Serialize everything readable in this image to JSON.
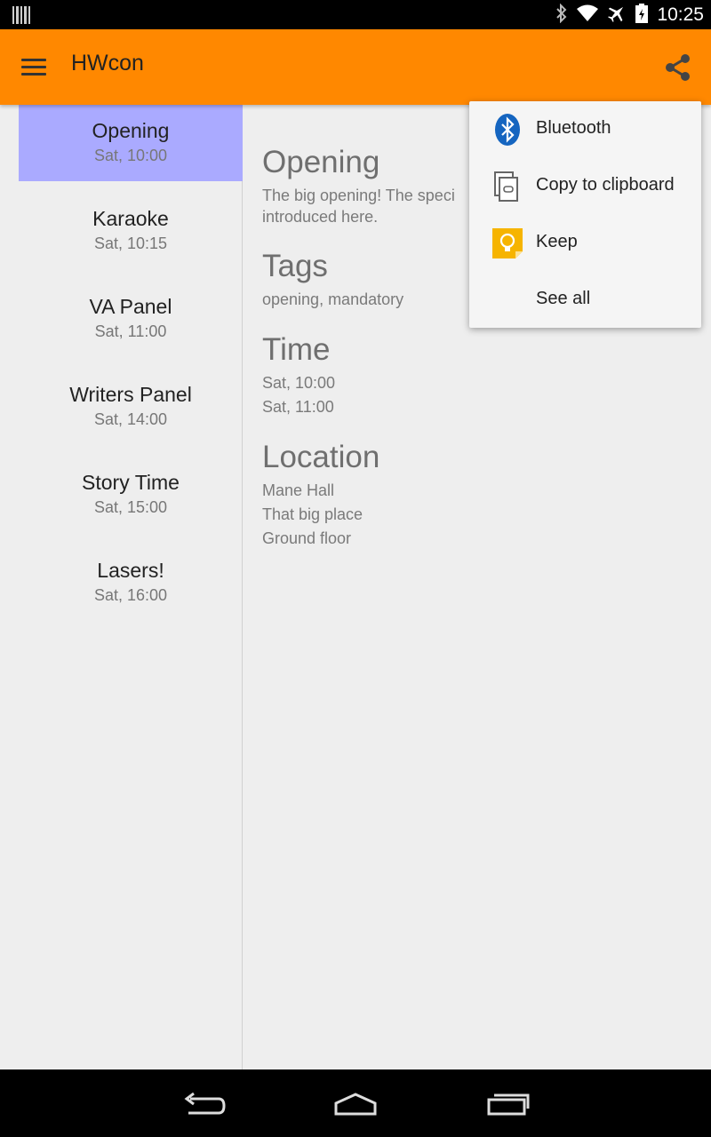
{
  "status_bar": {
    "time": "10:25",
    "icons": [
      "barcode-icon",
      "bluetooth-icon",
      "wifi-icon",
      "airplane-icon",
      "battery-icon"
    ]
  },
  "app_bar": {
    "title": "HWcon",
    "background": "#FF8800",
    "menu_icon": "menu-icon",
    "share_icon": "share-icon"
  },
  "events": [
    {
      "title": "Opening",
      "time": "Sat, 10:00",
      "selected": true
    },
    {
      "title": "Karaoke",
      "time": "Sat, 10:15",
      "selected": false
    },
    {
      "title": "VA Panel",
      "time": "Sat, 11:00",
      "selected": false
    },
    {
      "title": "Writers Panel",
      "time": "Sat, 14:00",
      "selected": false
    },
    {
      "title": "Story Time",
      "time": "Sat, 15:00",
      "selected": false
    },
    {
      "title": "Lasers!",
      "time": "Sat, 16:00",
      "selected": false
    }
  ],
  "selected_color": "#AAAAFF",
  "detail": {
    "title": "Opening",
    "description_line1": "The big opening! The speci",
    "description_line2": "introduced here.",
    "tags_heading": "Tags",
    "tags": "opening, mandatory",
    "time_heading": "Time",
    "time_start": "Sat, 10:00",
    "time_end": "Sat, 11:00",
    "location_heading": "Location",
    "location_line1": "Mane Hall",
    "location_line2": "That big place",
    "location_line3": "Ground floor"
  },
  "share_menu": {
    "items": [
      {
        "label": "Bluetooth",
        "icon": "bluetooth-icon"
      },
      {
        "label": "Copy to clipboard",
        "icon": "clipboard-icon"
      },
      {
        "label": "Keep",
        "icon": "keep-icon"
      },
      {
        "label": "See all",
        "icon": ""
      }
    ]
  },
  "nav_bar": {
    "icons": [
      "back-icon",
      "home-icon",
      "recents-icon"
    ]
  }
}
